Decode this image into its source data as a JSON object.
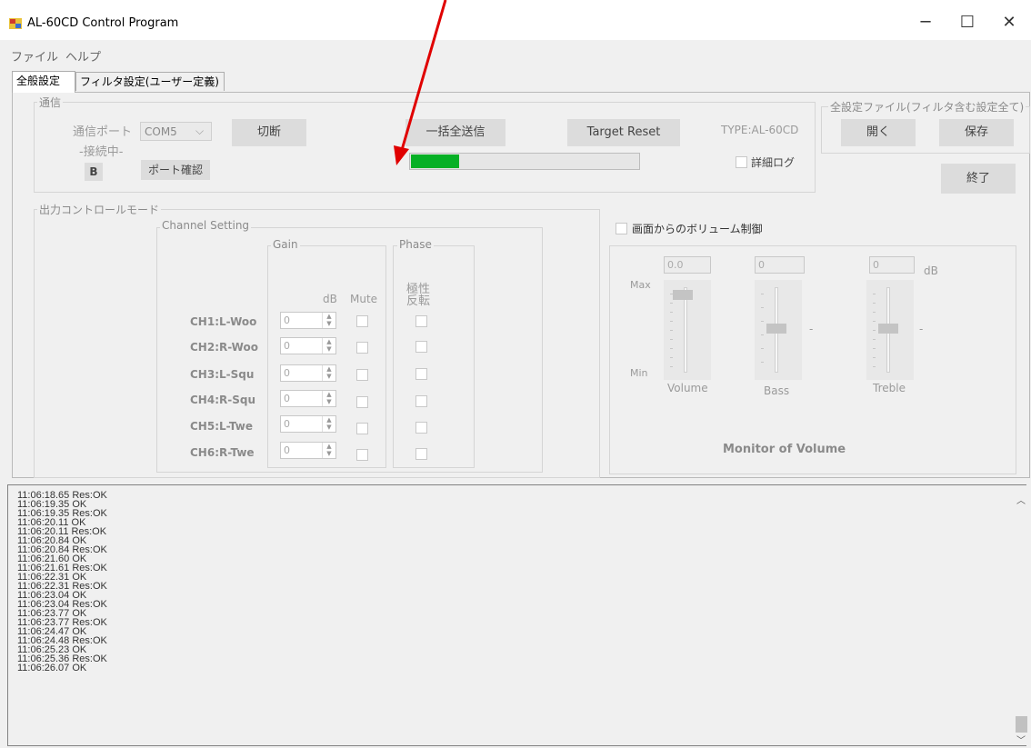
{
  "window": {
    "title": "AL-60CD Control Program",
    "minimize": "─",
    "maximize": "☐",
    "close": "✕"
  },
  "menu": [
    "ファイル",
    "ヘルプ"
  ],
  "tabs": [
    "全般設定",
    "フィルタ設定(ユーザー定義)"
  ],
  "comm": {
    "group_label": "通信",
    "port_label": "通信ポート",
    "status": "-接続中-",
    "port_value": "COM5",
    "disconnect_button": "切断",
    "b_badge": "B",
    "port_check_button": "ポート確認",
    "send_all_button": "一括全送信",
    "target_reset_button": "Target Reset",
    "type_label": "TYPE:AL-60CD",
    "detail_log_label": "詳細ログ",
    "progress_percent": 21
  },
  "file_group": {
    "label": "全設定ファイル(フィルタ含む設定全て)",
    "open_button": "開く",
    "save_button": "保存"
  },
  "exit_button": "終了",
  "output_group_label": "出力コントロールモード",
  "channel_setting": {
    "label": "Channel Setting",
    "gain_label": "Gain",
    "phase_label": "Phase",
    "db_header": "dB",
    "mute_header": "Mute",
    "phase_header_1": "極性",
    "phase_header_2": "反転",
    "channels": [
      {
        "name": "CH1:L-Woo",
        "gain": "0"
      },
      {
        "name": "CH2:R-Woo",
        "gain": "0"
      },
      {
        "name": "CH3:L-Squ",
        "gain": "0"
      },
      {
        "name": "CH4:R-Squ",
        "gain": "0"
      },
      {
        "name": "CH5:L-Twe",
        "gain": "0"
      },
      {
        "name": "CH6:R-Twe",
        "gain": "0"
      }
    ]
  },
  "volume": {
    "control_label": "画面からのボリューム制御",
    "volume_value": "0.0",
    "bass_value": "0",
    "treble_value": "0",
    "db_unit": "dB",
    "max_label": "Max",
    "min_label": "Min",
    "volume_label": "Volume",
    "bass_label": "Bass",
    "treble_label": "Treble",
    "dash": "-",
    "monitor_label": "Monitor of Volume"
  },
  "log": [
    "11:06:18.65 Res:OK",
    "11:06:19.35 OK",
    "11:06:19.35 Res:OK",
    "11:06:20.11 OK",
    "11:06:20.11 Res:OK",
    "11:06:20.84 OK",
    "11:06:20.84 Res:OK",
    "11:06:21.60 OK",
    "11:06:21.61 Res:OK",
    "11:06:22.31 OK",
    "11:06:22.31 Res:OK",
    "11:06:23.04 OK",
    "11:06:23.04 Res:OK",
    "11:06:23.77 OK",
    "11:06:23.77 Res:OK",
    "11:06:24.47 OK",
    "11:06:24.48 Res:OK",
    "11:06:25.23 OK",
    "11:06:25.36 Res:OK",
    "11:06:26.07 OK"
  ],
  "colors": {
    "progress_fill": "#06b025",
    "arrow": "#e00000"
  }
}
